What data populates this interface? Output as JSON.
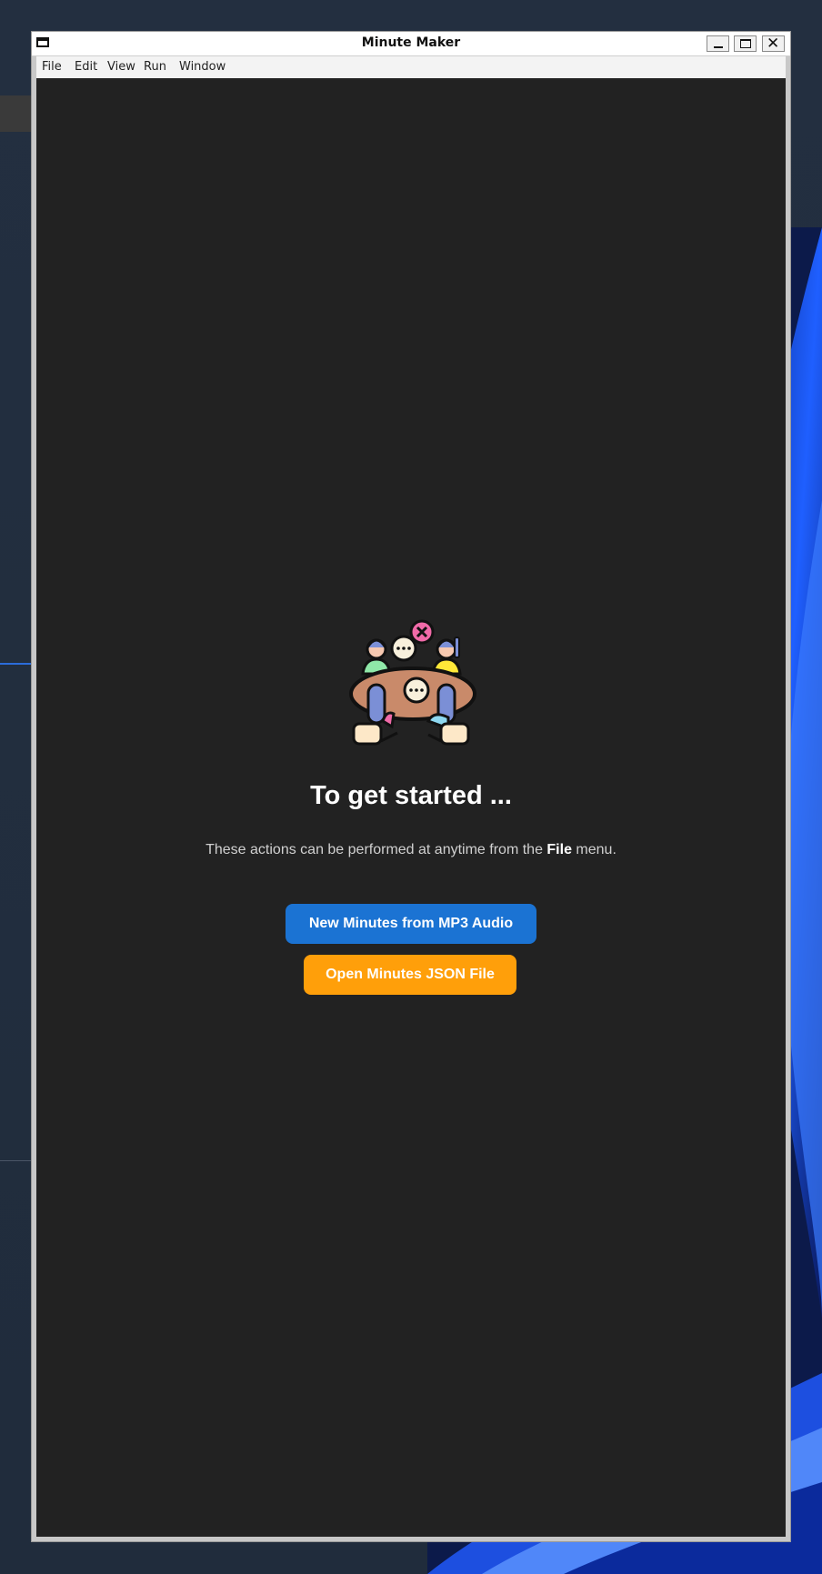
{
  "window": {
    "title": "Minute Maker"
  },
  "menubar": {
    "items": [
      {
        "label": "File"
      },
      {
        "label": "Edit"
      },
      {
        "label": "View"
      },
      {
        "label": "Run"
      },
      {
        "label": "Window"
      }
    ]
  },
  "main": {
    "heading": "To get started ...",
    "subtitle_pre": "These actions can be performed at anytime from the ",
    "subtitle_bold": "File",
    "subtitle_post": " menu.",
    "new_button_label": "New Minutes from MP3 Audio",
    "open_button_label": "Open Minutes JSON File",
    "illustration_icon": "meeting-people-icon"
  },
  "colors": {
    "content_bg": "#222222",
    "primary_button": "#1b73d3",
    "secondary_button": "#ff9f0a"
  }
}
